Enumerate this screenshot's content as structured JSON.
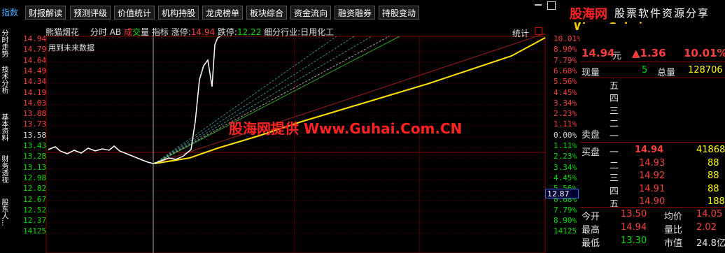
{
  "toolbar": {
    "buttons": [
      "指数",
      "财报解读",
      "预测评级",
      "价值统计",
      "机构持股",
      "龙虎榜单",
      "板块综合",
      "资金流向",
      "融资融券",
      "持股变动"
    ]
  },
  "watermark": {
    "site_cn": "股海网",
    "site_desc": "股票软件资源分享",
    "site_url": "Www.Guhai.com.cn",
    "center_text": "股海网提供 Www.Guhai.Com.CN"
  },
  "left_tabs": [
    "分时走势",
    "技术分析",
    "基本资料",
    "财务透视",
    "股东人..."
  ],
  "chart": {
    "header": {
      "stock_name": "熊猫烟花",
      "mode": "分时",
      "ab": "AB",
      "cheng": "成",
      "jiao": "交",
      "liang": "量",
      "indicator": "指标",
      "limit_up_label": "涨停:",
      "limit_up_value": "14.94",
      "limit_down_label": "跌停:",
      "limit_down_value": "12.22",
      "industry_label": "细分行业:",
      "industry_value": "日用化工",
      "stats_link": "统计"
    },
    "note": "用到未来数据",
    "y_left": [
      "14.94",
      "14.79",
      "14.64",
      "14.49",
      "14.34",
      "14.19",
      "14.03",
      "13.88",
      "13.73",
      "13.58",
      "13.43",
      "13.28",
      "13.13",
      "12.98",
      "12.82",
      "12.67",
      "12.52",
      "12.37",
      "14125"
    ],
    "y_right": [
      "10.01%",
      "8.90%",
      "7.79%",
      "6.68%",
      "5.56%",
      "4.45%",
      "3.34%",
      "2.23%",
      "1.11%",
      "0.00%",
      "1.11%",
      "2.23%",
      "3.34%",
      "4.45%",
      "5.56%",
      "6.68%",
      "7.79%",
      "8.90%",
      "14125"
    ],
    "cursor_price": "12.87",
    "colors": {
      "up": "#ff3c3c",
      "down": "#00e000",
      "flat": "#ffffff",
      "grid": "#8b0000"
    }
  },
  "panel": {
    "title_name": "熊猫烟花",
    "price": "14.94",
    "price_unit": "元",
    "change": "▲1.36",
    "change_pct": "10.01%",
    "xianliang_label": "现量",
    "xianliang": "5",
    "zongliang_label": "总量",
    "zongliang": "128706",
    "sell_label": "卖盘",
    "buy_label": "买盘",
    "sell_levels": [
      "五",
      "四",
      "三",
      "二",
      "一"
    ],
    "buy": [
      {
        "level": "一",
        "price": "14.94",
        "vol": "41868"
      },
      {
        "level": "二",
        "price": "14.93",
        "vol": "88"
      },
      {
        "level": "三",
        "price": "14.92",
        "vol": "88"
      },
      {
        "level": "四",
        "price": "14.91",
        "vol": "88"
      },
      {
        "level": "五",
        "price": "14.90",
        "vol": "188"
      }
    ],
    "stats": [
      {
        "l1": "今开",
        "v1": "13.50",
        "l2": "均价",
        "v2": "14.05"
      },
      {
        "l1": "最高",
        "v1": "14.94",
        "l2": "量比",
        "v2": "2.02"
      },
      {
        "l1": "最低",
        "v1": "13.30",
        "l2": "市值",
        "v2": "24.8亿"
      }
    ]
  }
}
